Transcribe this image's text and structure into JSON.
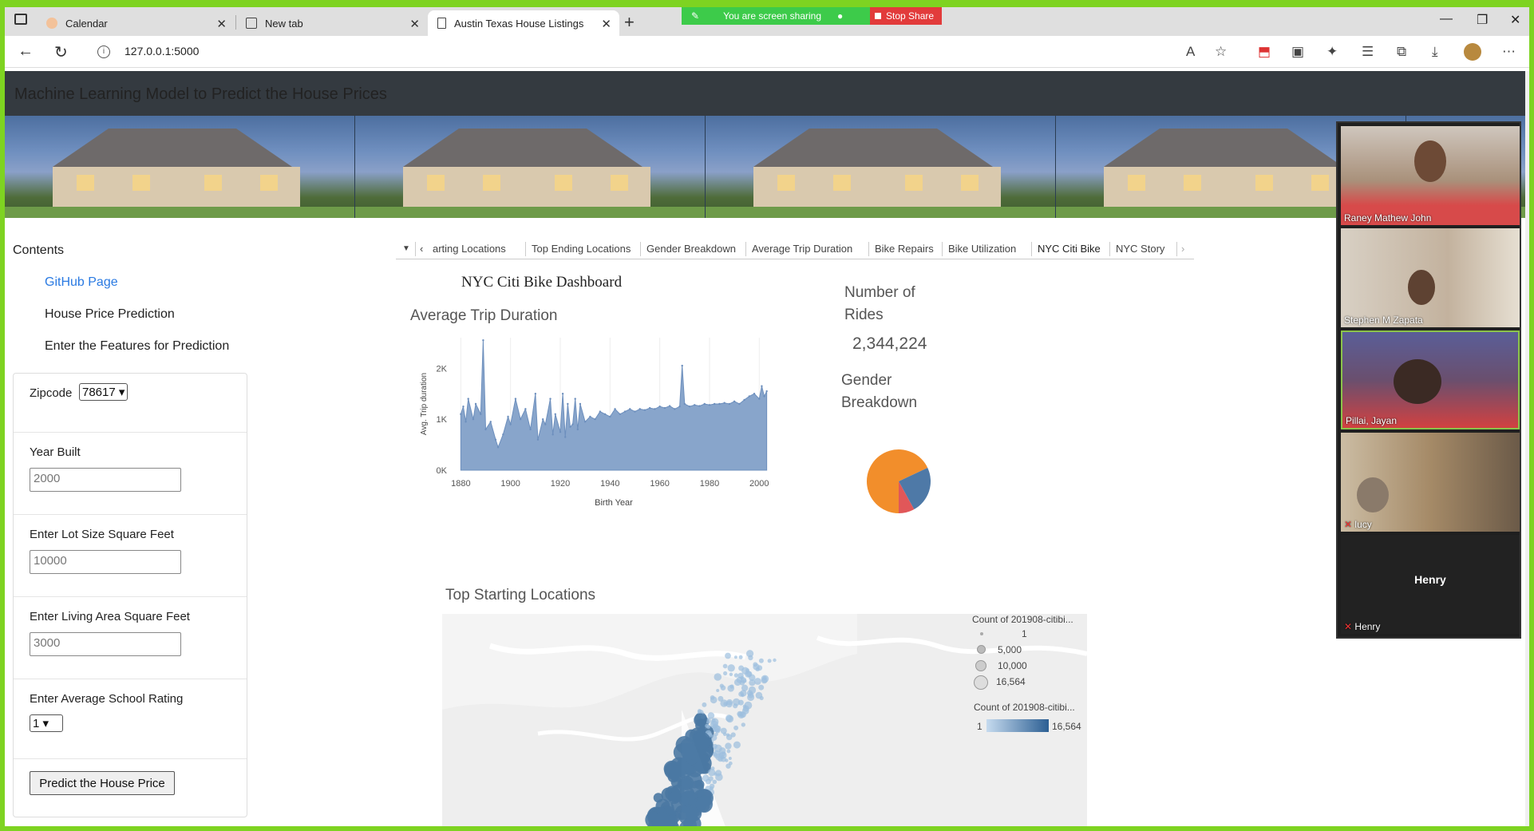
{
  "browser": {
    "tabs": [
      {
        "label": "Calendar"
      },
      {
        "label": "New tab"
      },
      {
        "label": "Austin Texas House Listings"
      }
    ],
    "url": "127.0.0.1:5000",
    "screen_share": {
      "status": "You are screen sharing",
      "stop_label": "Stop Share"
    }
  },
  "page": {
    "header_title": "Machine Learning Model to Predict the House Prices"
  },
  "sidebar": {
    "contents_title": "Contents",
    "links": [
      {
        "label": "GitHub Page"
      },
      {
        "label": "House Price Prediction"
      },
      {
        "label": "Enter the Features for Prediction"
      }
    ],
    "accent_link_color": "#2a7ae2"
  },
  "form": {
    "zipcode_label": "Zipcode",
    "zipcode_value": "78617",
    "year_built_label": "Year Built",
    "year_built_placeholder": "2000",
    "lot_size_label": "Enter Lot Size Square Feet",
    "lot_size_placeholder": "10000",
    "living_area_label": "Enter Living Area Square Feet",
    "living_area_placeholder": "3000",
    "school_rating_label": "Enter Average School Rating",
    "school_rating_value": "1",
    "predict_label": "Predict the House Price"
  },
  "tableau": {
    "tabs": [
      {
        "label": "arting Locations"
      },
      {
        "label": "Top Ending Locations"
      },
      {
        "label": "Gender Breakdown"
      },
      {
        "label": "Average Trip Duration"
      },
      {
        "label": "Bike Repairs"
      },
      {
        "label": "Bike Utilization"
      },
      {
        "label": "NYC Citi Bike"
      },
      {
        "label": "NYC Story"
      }
    ],
    "dashboard_title": "NYC Citi Bike Dashboard",
    "avg_trip_title": "Average Trip Duration",
    "rides_title_line1": "Number of",
    "rides_title_line2": "Rides",
    "rides_value": "2,344,224",
    "gender_title_line1": "Gender",
    "gender_title_line2": "Breakdown",
    "map_title": "Top Starting Locations",
    "legend": {
      "size_title": "Count of 201908-citibi...",
      "size_items": [
        "1",
        "5,000",
        "10,000",
        "16,564"
      ],
      "color_title": "Count of 201908-citibi...",
      "color_min": "1",
      "color_max": "16,564"
    }
  },
  "chart_data": [
    {
      "type": "area",
      "title": "Average Trip Duration",
      "xlabel": "Birth Year",
      "ylabel": "Avg. Trip duration",
      "x_ticks": [
        "1880",
        "1900",
        "1920",
        "1940",
        "1960",
        "1980",
        "2000"
      ],
      "y_ticks": [
        "0K",
        "1K",
        "2K"
      ],
      "xlim": [
        1877,
        2006
      ],
      "ylim": [
        0,
        2600
      ],
      "x": [
        1880,
        1881,
        1882,
        1883,
        1885,
        1886,
        1888,
        1889,
        1890,
        1892,
        1894,
        1895,
        1897,
        1899,
        1900,
        1902,
        1904,
        1906,
        1908,
        1910,
        1911,
        1913,
        1914,
        1916,
        1917,
        1918,
        1920,
        1921,
        1922,
        1923,
        1924,
        1925,
        1926,
        1927,
        1928,
        1930,
        1932,
        1934,
        1936,
        1938,
        1940,
        1942,
        1944,
        1946,
        1948,
        1950,
        1952,
        1954,
        1956,
        1958,
        1960,
        1962,
        1964,
        1966,
        1968,
        1969,
        1970,
        1972,
        1974,
        1976,
        1978,
        1980,
        1982,
        1984,
        1986,
        1988,
        1990,
        1992,
        1994,
        1996,
        1998,
        2000,
        2001,
        2002,
        2003
      ],
      "y": [
        1100,
        1250,
        950,
        1400,
        1000,
        1300,
        1100,
        2550,
        800,
        950,
        600,
        450,
        700,
        1050,
        900,
        1400,
        1000,
        1200,
        800,
        1500,
        600,
        1000,
        900,
        1400,
        700,
        1100,
        750,
        1500,
        650,
        1300,
        850,
        900,
        1400,
        800,
        1300,
        950,
        1050,
        1000,
        1150,
        1100,
        1050,
        1200,
        1100,
        1150,
        1200,
        1150,
        1200,
        1180,
        1220,
        1200,
        1250,
        1220,
        1260,
        1200,
        1250,
        2050,
        1300,
        1250,
        1280,
        1260,
        1300,
        1280,
        1300,
        1300,
        1320,
        1300,
        1350,
        1300,
        1380,
        1450,
        1500,
        1400,
        1650,
        1450,
        1550
      ]
    },
    {
      "type": "pie",
      "title": "Gender Breakdown",
      "values": [
        68,
        24,
        8
      ],
      "colors": [
        "#f28e2b",
        "#4e79a7",
        "#e15759"
      ]
    }
  ]
}
